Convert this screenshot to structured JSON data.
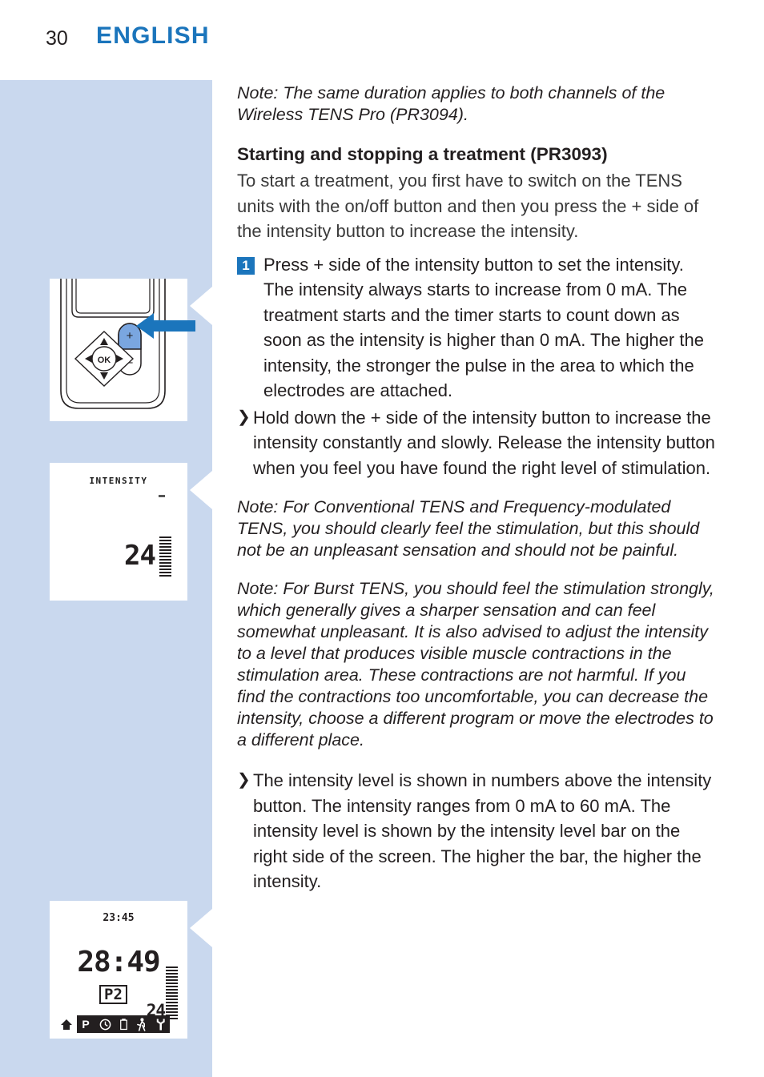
{
  "header": {
    "page_number": "30",
    "language": "ENGLISH",
    "accent_color": "#1b75bc"
  },
  "sidebar": {
    "background_color": "#c9d8ee",
    "figures": [
      {
        "name": "device-intensity-button",
        "caption_icons": [
          "plus",
          "minus",
          "OK",
          "up-arrow",
          "down-arrow",
          "left-arrow",
          "right-arrow"
        ],
        "plus_label": "+",
        "minus_label": "−",
        "ok_label": "OK"
      },
      {
        "name": "lcd-intensity-screen",
        "label": "INTENSITY",
        "value": "24"
      },
      {
        "name": "lcd-status-screen",
        "clock": "23:45",
        "timer": "28:49",
        "program": "P2",
        "intensity": "24",
        "status_icons": [
          "home-icon",
          "P",
          "clock-icon",
          "battery-icon",
          "walking-icon",
          "wrench-icon"
        ]
      }
    ]
  },
  "main": {
    "note_top": "Note: The same duration applies to both channels of the Wireless TENS Pro (PR3094).",
    "heading": "Starting and stopping a treatment (PR3093)",
    "intro": "To start a treatment, you first have to switch on the TENS units with the on/off button and then you press the + side of the intensity button to increase the intensity.",
    "step_1_number": "1",
    "step_1": "Press + side of the intensity button to set the intensity. The intensity always starts to increase from 0 mA. The treatment starts and the timer starts to count down as soon as the intensity is higher than 0 mA. The higher the intensity, the stronger the pulse in the area to which the electrodes are attached.",
    "bullet_1": "Hold down the + side of the intensity button to increase the intensity constantly and slowly. Release the intensity button when you feel you have found the right level of stimulation.",
    "note_mid": "Note: For Conventional TENS and Frequency-modulated TENS, you should clearly feel the stimulation, but this should not be an unpleasant sensation and should not be painful.",
    "note_burst": "Note: For Burst TENS, you should feel the stimulation strongly, which generally gives a sharper sensation and can feel somewhat unpleasant. It is also advised to adjust the intensity to a level that produces visible muscle contractions in the stimulation area. These contractions are not harmful. If you find the contractions too uncomfortable, you can decrease the intensity, choose a different program or move the electrodes to a different place.",
    "bullet_2": "The intensity level is shown in numbers above the intensity button. The intensity ranges from 0 mA to 60 mA. The intensity level is shown by the intensity level bar on the right side of the screen. The higher the bar, the higher the intensity.",
    "bullet_glyph": "❯"
  }
}
